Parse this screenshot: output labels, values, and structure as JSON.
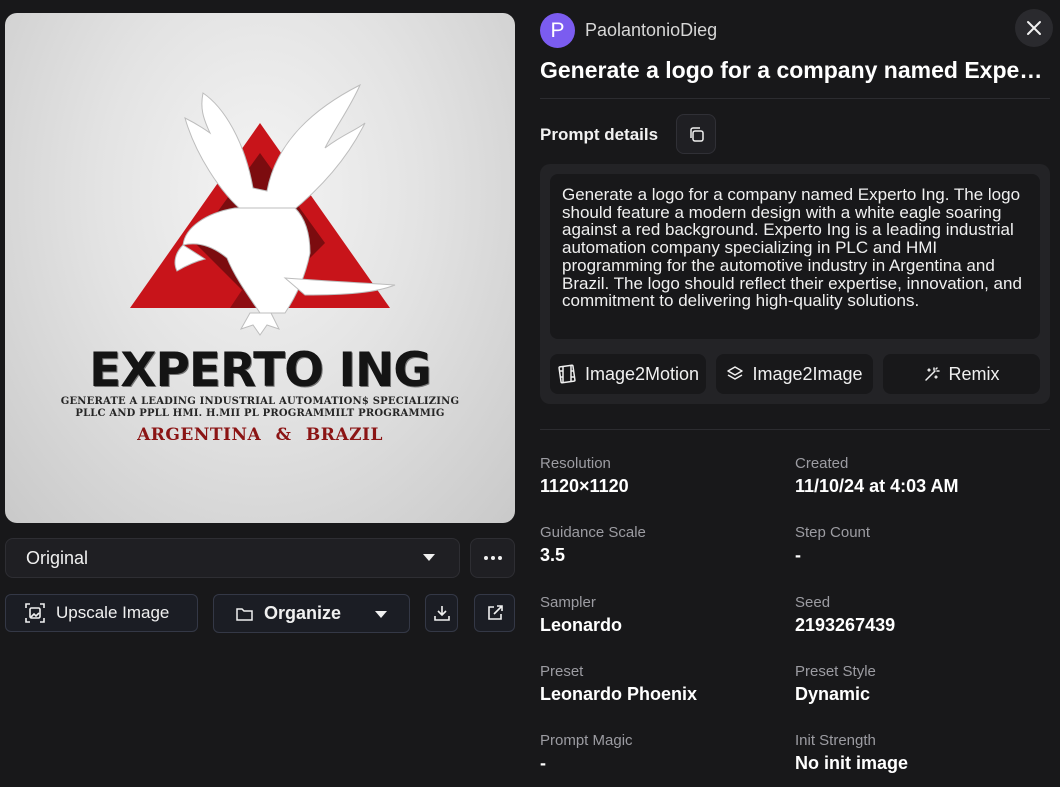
{
  "image": {
    "logo_title": "EXPERTO ING",
    "logo_line1": "GENERATE A LEADING  INDUSTRIAL AUTOMATION$ SPECIALIZING",
    "logo_line2": "PLLC AND PPLL  HMI. H.MII PL PROGRAMMILT PROGRAMMIG",
    "logo_country": "ARGENTINA & BRAZIL",
    "colors": {
      "triangle": "#c8141a",
      "triangle_dark": "#6e0a0e",
      "eagle": "#ffffff"
    }
  },
  "controls": {
    "variant_select": "Original",
    "upscale_label": "Upscale Image",
    "organize_label": "Organize"
  },
  "header": {
    "avatar_letter": "P",
    "username": "PaolantonioDieg",
    "title": "Generate a logo for a company named Experto Ing."
  },
  "prompt": {
    "section_label": "Prompt details",
    "text": "Generate a logo for a company named Experto Ing. The logo should feature a modern design with a white eagle soaring against a red background. Experto Ing is a leading industrial automation company specializing in PLC and HMI programming for the automotive industry in Argentina and Brazil. The logo should reflect their expertise, innovation, and commitment to delivering high-quality solutions.",
    "actions": [
      "Image2Motion",
      "Image2Image",
      "Remix"
    ]
  },
  "details": [
    {
      "label": "Resolution",
      "value": "1120×1120"
    },
    {
      "label": "Created",
      "value": "11/10/24 at 4:03 AM"
    },
    {
      "label": "Guidance Scale",
      "value": "3.5"
    },
    {
      "label": "Step Count",
      "value": "-"
    },
    {
      "label": "Sampler",
      "value": "Leonardo"
    },
    {
      "label": "Seed",
      "value": "2193267439"
    },
    {
      "label": "Preset",
      "value": "Leonardo Phoenix"
    },
    {
      "label": "Preset Style",
      "value": "Dynamic"
    },
    {
      "label": "Prompt Magic",
      "value": "-"
    },
    {
      "label": "Init Strength",
      "value": "No init image"
    }
  ],
  "accent_color": "#7b5cf0"
}
